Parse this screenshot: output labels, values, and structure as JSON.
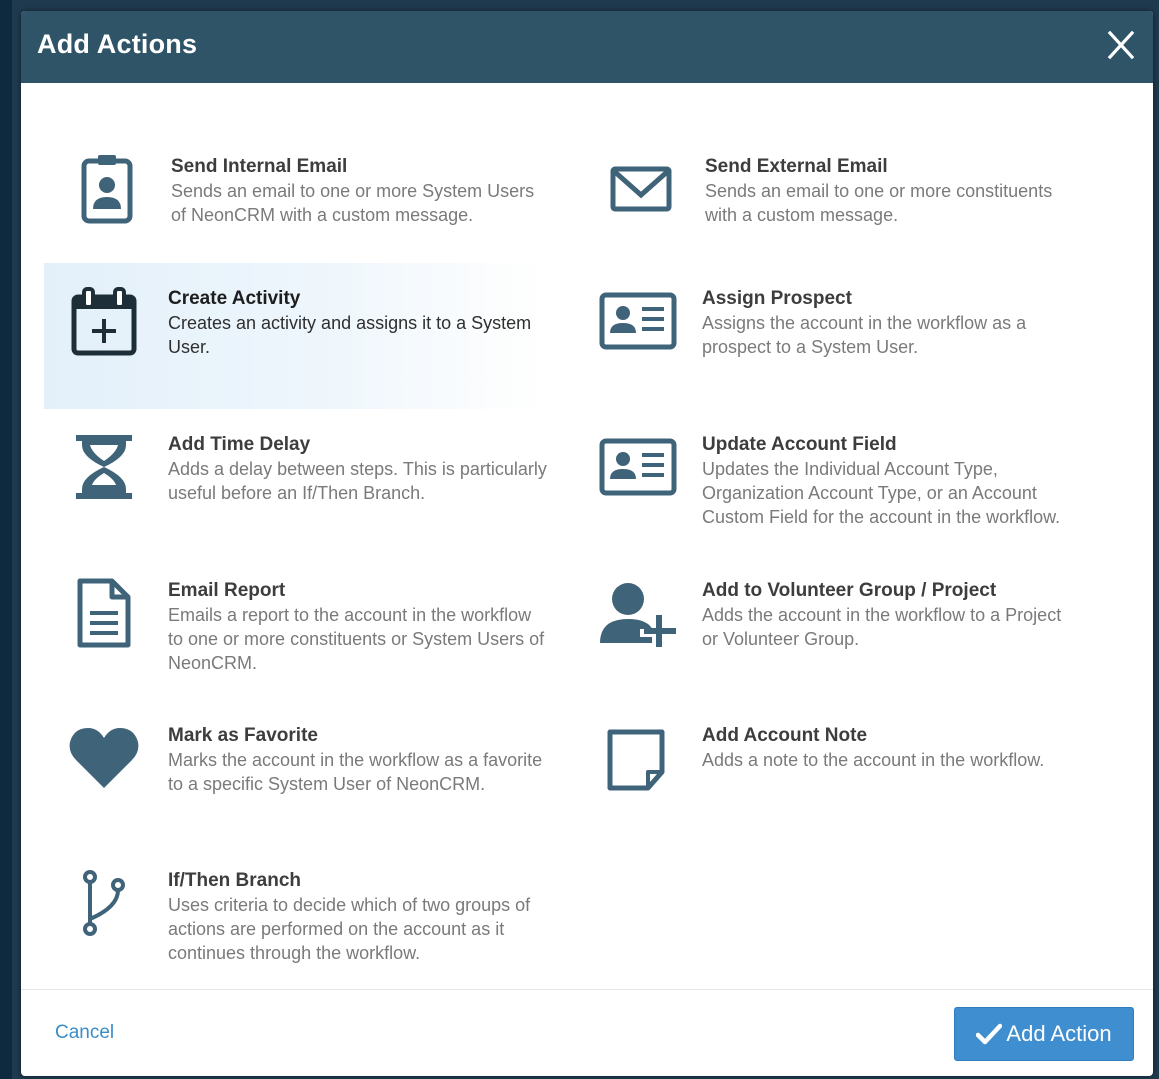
{
  "modal": {
    "title": "Add Actions",
    "close_label": "X"
  },
  "actions": [
    {
      "title": "Send Internal Email",
      "desc": "Sends an email to one or more System Users of NeonCRM with a custom message.",
      "icon": "badge-icon"
    },
    {
      "title": "Send External Email",
      "desc": "Sends an email to one or more constituents with a custom message.",
      "icon": "envelope-icon"
    },
    {
      "title": "Create Activity",
      "desc": "Creates an activity and assigns it to a System User.",
      "icon": "calendar-plus-icon"
    },
    {
      "title": "Assign Prospect",
      "desc": "Assigns the account in the workflow as a prospect to a System User.",
      "icon": "id-card-icon"
    },
    {
      "title": "Add Time Delay",
      "desc": "Adds a delay between steps. This is particularly useful before an If/Then Branch.",
      "icon": "hourglass-icon"
    },
    {
      "title": "Update Account Field",
      "desc": "Updates the Individual Account Type, Organization Account Type, or an Account Custom Field for the account in the workflow.",
      "icon": "id-card-icon"
    },
    {
      "title": "Email Report",
      "desc": "Emails a report to the account in the workflow to one or more constituents or System Users of NeonCRM.",
      "icon": "document-icon"
    },
    {
      "title": "Add to Volunteer Group / Project",
      "desc": "Adds the account in the workflow to a Project or Volunteer Group.",
      "icon": "user-plus-icon"
    },
    {
      "title": "Mark as Favorite",
      "desc": "Marks the account in the workflow as a favorite to a specific System User of NeonCRM.",
      "icon": "heart-icon"
    },
    {
      "title": "Add Account Note",
      "desc": "Adds a note to the account in the workflow.",
      "icon": "sticky-note-icon"
    },
    {
      "title": "If/Then Branch",
      "desc": "Uses criteria to decide which of two groups of actions are performed on the account as it continues through the workflow.",
      "icon": "branch-icon"
    }
  ],
  "footer": {
    "cancel_label": "Cancel",
    "add_action_label": "Add Action"
  },
  "colors": {
    "header": "#2f5468",
    "icon": "#3f6378",
    "primary_button": "#3f8ed0",
    "link": "#3a8dc7"
  }
}
